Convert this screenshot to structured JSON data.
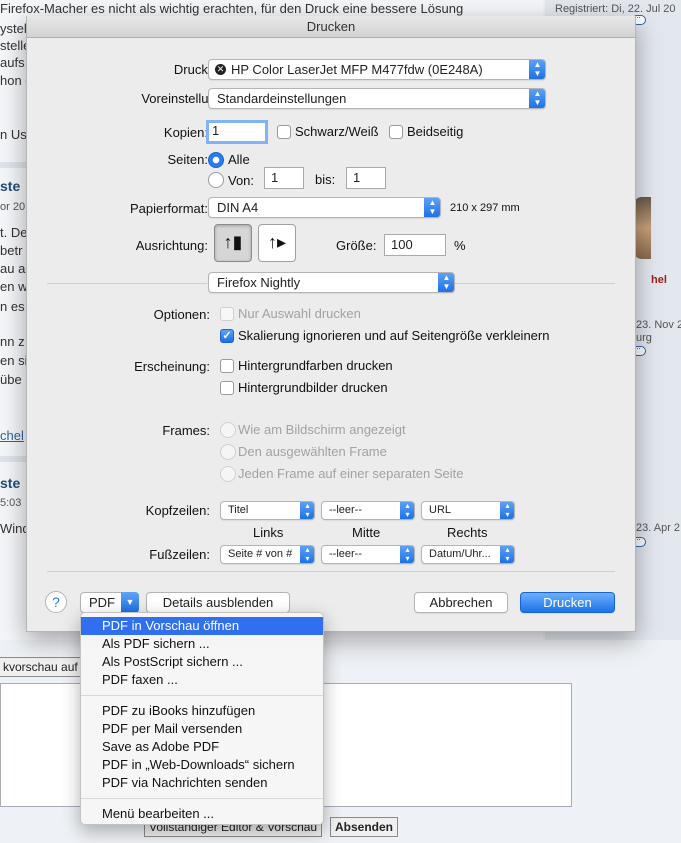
{
  "background": {
    "header_text": "Firefox-Macher es nicht als wichtig erachten, für den Druck eine bessere Lösung",
    "registered_text": "Registriert: Di, 22. Jul 20",
    "fragments_left": [
      "ystel",
      "stelle",
      "aufs",
      "hon e",
      "n Us",
      "ste",
      "or 20",
      "t. De",
      "betr",
      "au au",
      "en wa",
      "n es",
      "nn z",
      "en si",
      "übe",
      "chel",
      "ste",
      "5:03",
      "Wind"
    ],
    "side_red": "hel",
    "side_dates": [
      "23. Nov 2",
      "urg",
      "23. Apr 2"
    ],
    "editor_button_1": "kvorschau auf",
    "editor_button_2": "Vollständiger Editor & Vorschau",
    "submit_button": "Absenden"
  },
  "dialog": {
    "title": "Drucken",
    "printer": {
      "label": "Drucker:",
      "value": "HP Color LaserJet MFP M477fdw (0E248A)"
    },
    "preset": {
      "label": "Voreinstellung",
      "value": "Standardeinstellungen"
    },
    "copies": {
      "label": "Kopien:",
      "value": "1",
      "bw_label": "Schwarz/Weiß",
      "duplex_label": "Beidseitig"
    },
    "pages": {
      "label": "Seiten:",
      "all_label": "Alle",
      "from_label": "Von:",
      "from_value": "1",
      "to_label": "bis:",
      "to_value": "1"
    },
    "paper": {
      "label": "Papierformat:",
      "value": "DIN A4",
      "dimensions": "210 x 297 mm"
    },
    "orientation": {
      "label": "Ausrichtung:",
      "size_label": "Größe:",
      "size_value": "100",
      "percent": "%"
    },
    "section_popup": "Firefox Nightly",
    "options": {
      "label": "Optionen:",
      "selection_only": "Nur Auswahl drucken",
      "shrink_to_fit": "Skalierung ignorieren und auf Seitengröße verkleinern"
    },
    "appearance": {
      "label": "Erscheinung:",
      "bg_colors": "Hintergrundfarben drucken",
      "bg_images": "Hintergrundbilder drucken"
    },
    "frames": {
      "label": "Frames:",
      "as_shown": "Wie am Bildschirm angezeigt",
      "selected": "Den ausgewählten Frame",
      "each_separate": "Jeden Frame auf einer separaten Seite"
    },
    "headers": {
      "label": "Kopfzeilen:",
      "left": "Titel",
      "center": "--leer--",
      "right": "URL"
    },
    "column_labels": {
      "left": "Links",
      "center": "Mitte",
      "right": "Rechts"
    },
    "footers": {
      "label": "Fußzeilen:",
      "left": "Seite # von #",
      "center": "--leer--",
      "right": "Datum/Uhr..."
    },
    "bottom": {
      "help": "?",
      "pdf": "PDF",
      "details": "Details ausblenden",
      "cancel": "Abbrechen",
      "print": "Drucken"
    }
  },
  "pdf_menu": {
    "group1": [
      "PDF in Vorschau öffnen",
      "Als PDF sichern ...",
      "Als PostScript sichern ...",
      "PDF faxen ..."
    ],
    "group2": [
      "PDF zu iBooks hinzufügen",
      "PDF per Mail versenden",
      "Save as Adobe PDF",
      "PDF in „Web-Downloads“ sichern",
      "PDF via Nachrichten senden"
    ],
    "group3": [
      "Menü bearbeiten ..."
    ]
  },
  "colors": {
    "accent": "#2f6ff0",
    "sheet": "#ececec"
  }
}
